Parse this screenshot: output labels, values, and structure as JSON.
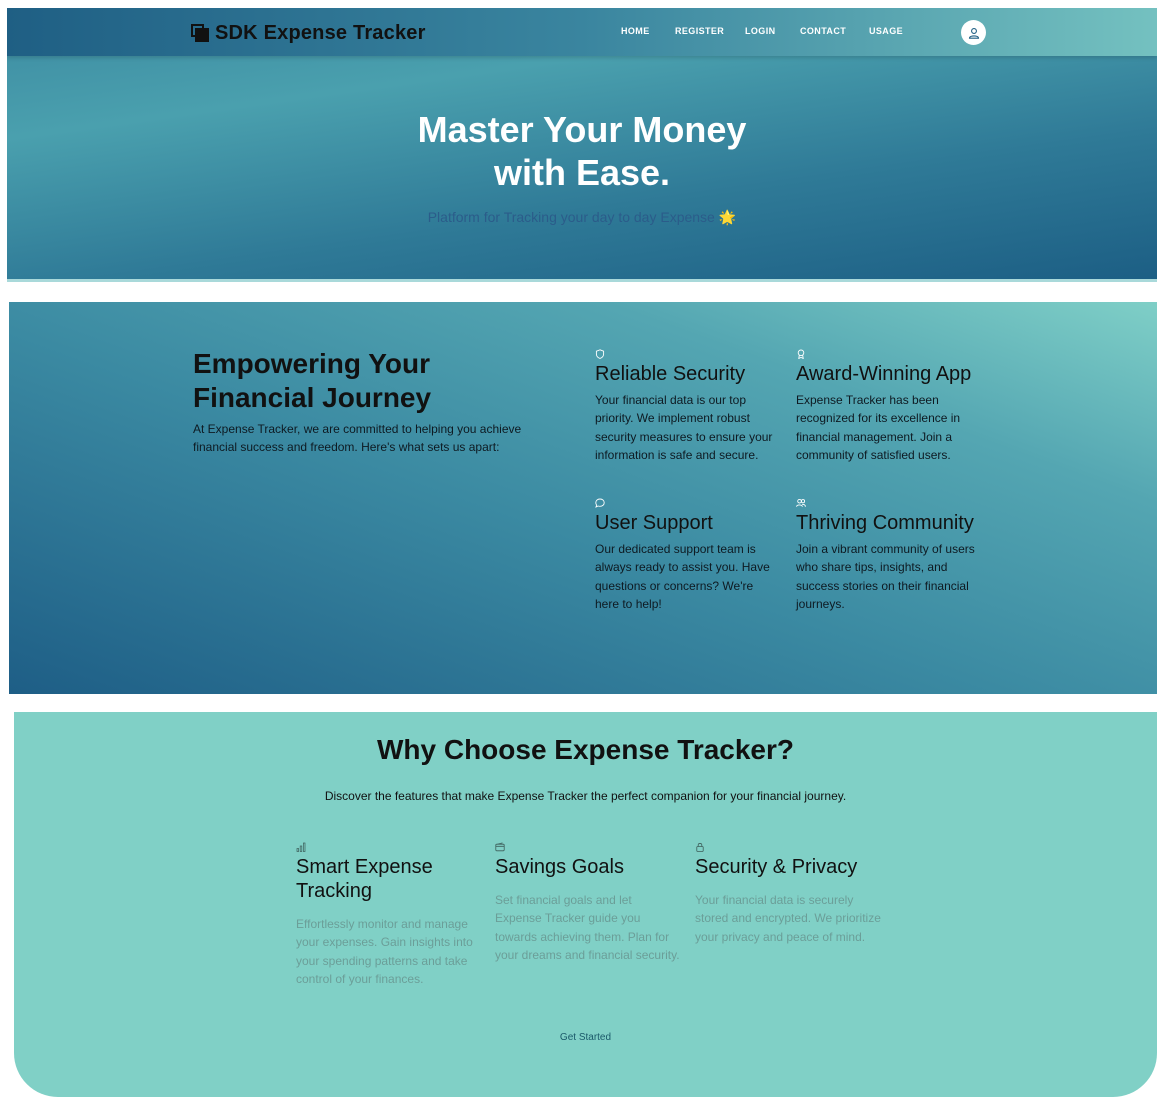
{
  "navbar": {
    "brand": "SDK Expense Tracker",
    "links": [
      "HOME",
      "REGISTER",
      "LOGIN",
      "CONTACT",
      "USAGE"
    ]
  },
  "hero": {
    "title": "Master Your Money with Ease.",
    "subtitle": "Platform for Tracking your day to day Expense",
    "subtitle_emoji": "🌟"
  },
  "about": {
    "title": "Empowering Your Financial Journey",
    "description": "At Expense Tracker, we are committed to helping you achieve financial success and freedom. Here's what sets us apart:",
    "features": [
      {
        "icon": "shield-icon",
        "title": "Reliable Security",
        "text": "Your financial data is our top priority. We implement robust security measures to ensure your information is safe and secure."
      },
      {
        "icon": "award-icon",
        "title": "Award-Winning App",
        "text": "Expense Tracker has been recognized for its excellence in financial management. Join a community of satisfied users."
      },
      {
        "icon": "chat-icon",
        "title": "User Support",
        "text": "Our dedicated support team is always ready to assist you. Have questions or concerns? We're here to help!"
      },
      {
        "icon": "users-icon",
        "title": "Thriving Community",
        "text": "Join a vibrant community of users who share tips, insights, and success stories on their financial journeys."
      }
    ]
  },
  "why": {
    "title": "Why Choose Expense Tracker?",
    "subtitle": "Discover the features that make Expense Tracker the perfect companion for your financial journey.",
    "cards": [
      {
        "icon": "bar-chart-icon",
        "title": "Smart Expense Tracking",
        "text": "Effortlessly monitor and manage your expenses. Gain insights into your spending patterns and take control of your finances."
      },
      {
        "icon": "wallet-icon",
        "title": "Savings Goals",
        "text": "Set financial goals and let Expense Tracker guide you towards achieving them. Plan for your dreams and financial security."
      },
      {
        "icon": "lock-icon",
        "title": "Security & Privacy",
        "text": "Your financial data is securely stored and encrypted. We prioritize your privacy and peace of mind."
      }
    ],
    "cta": "Get Started"
  },
  "colors": {
    "hero_dark": "#1c5e84",
    "hero_light": "#4aa0ae",
    "why_bg": "#80d0c6",
    "subtitle_blue": "#2b5c8a"
  }
}
